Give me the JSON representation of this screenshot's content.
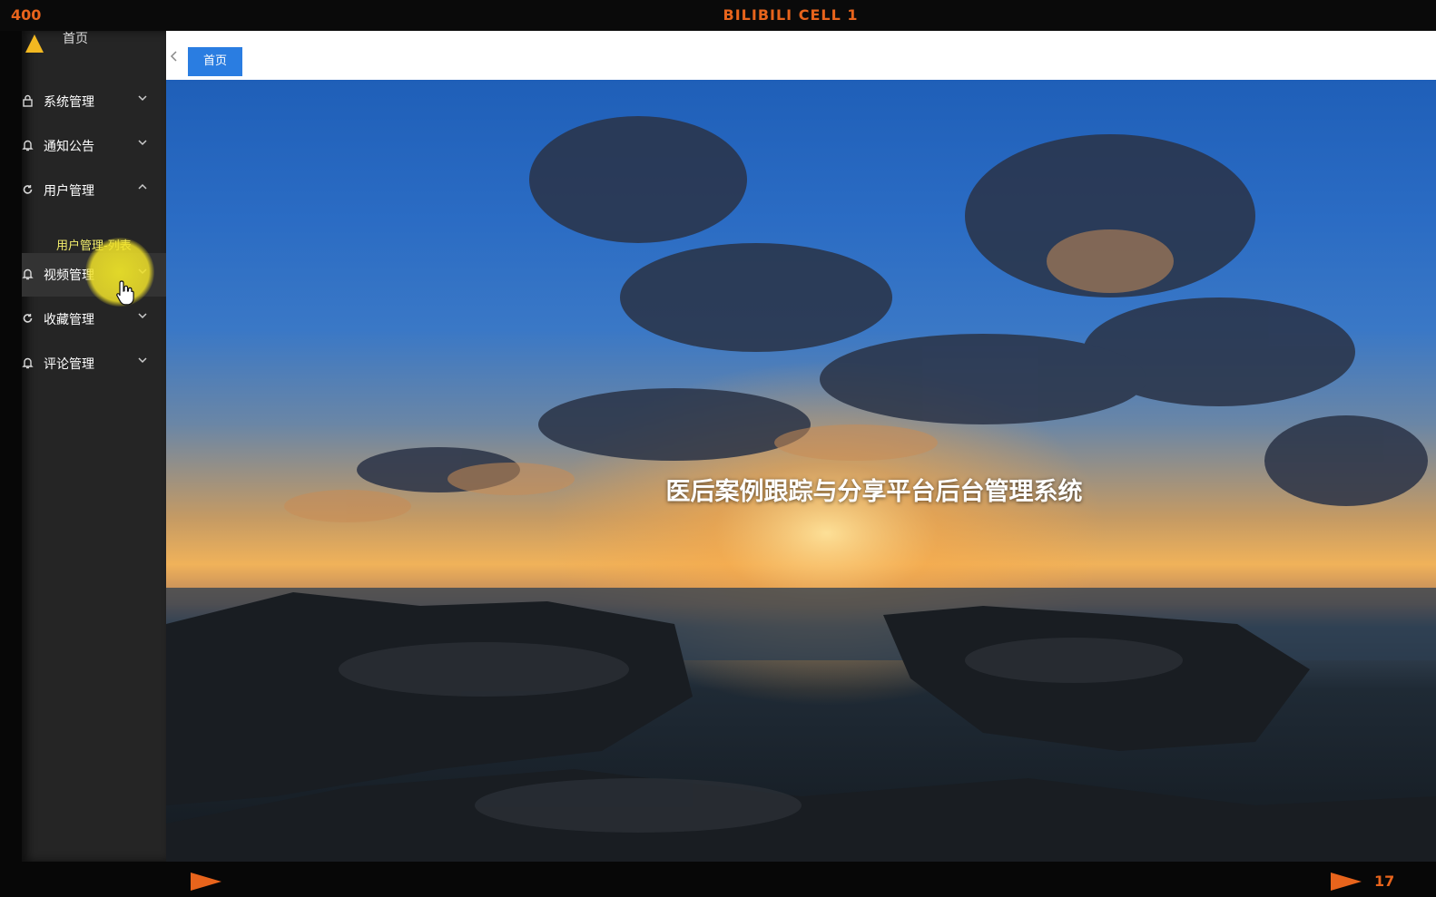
{
  "recording": {
    "counter": "400",
    "cell_title": "BILIBILI  CELL  1",
    "frame_number": "17"
  },
  "sidebar": {
    "home": {
      "label": "首页",
      "icon": "logo-icon"
    },
    "items": [
      {
        "label": "系统管理",
        "icon": "lock-icon",
        "chevron": "chevron-down-icon"
      },
      {
        "label": "通知公告",
        "icon": "bell-icon",
        "chevron": "chevron-down-icon"
      },
      {
        "label": "用户管理",
        "icon": "refresh-icon",
        "chevron": "chevron-up-icon"
      },
      {
        "label": "视频管理",
        "icon": "bell-icon",
        "chevron": "chevron-down-icon"
      },
      {
        "label": "收藏管理",
        "icon": "refresh-icon",
        "chevron": "chevron-down-icon"
      },
      {
        "label": "评论管理",
        "icon": "bell-icon",
        "chevron": "chevron-down-icon"
      }
    ],
    "submenu": {
      "label": "用户管理-列表"
    }
  },
  "tabs": {
    "active": {
      "label": "首页"
    }
  },
  "hero": {
    "title": "医后案例跟踪与分享平台后台管理系统"
  },
  "colors": {
    "accent": "#2a7de1",
    "sidebar_bg": "#252525",
    "film_text": "#e8641c",
    "submenu_text": "#f4ef6c"
  }
}
